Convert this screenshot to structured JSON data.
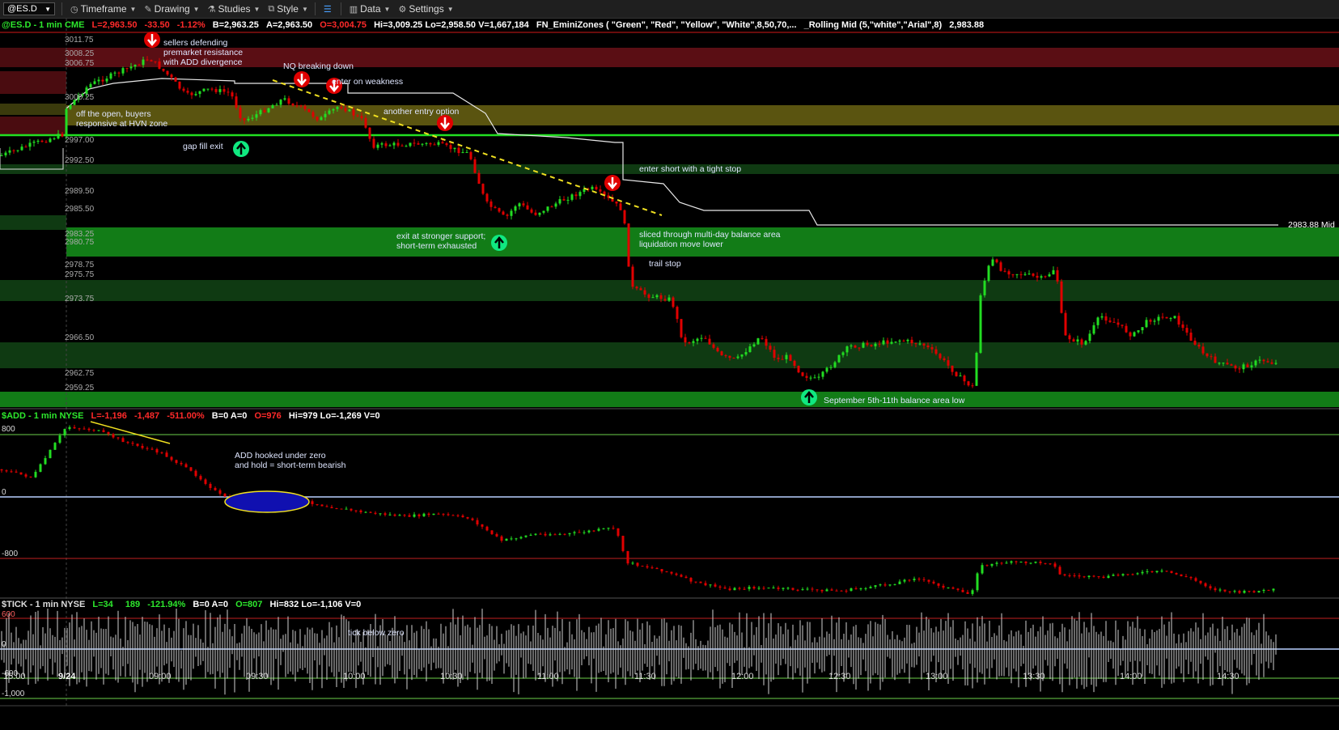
{
  "toolbar": {
    "symbol": "@ES.D",
    "items": [
      {
        "name": "timeframe",
        "label": "Timeframe",
        "icon": "clock-icon"
      },
      {
        "name": "drawing",
        "label": "Drawing",
        "icon": "pencil-icon"
      },
      {
        "name": "studies",
        "label": "Studies",
        "icon": "flask-icon"
      },
      {
        "name": "style",
        "label": "Style",
        "icon": "style-icon"
      },
      {
        "name": "data",
        "label": "Data",
        "icon": "bar-chart-icon"
      },
      {
        "name": "settings",
        "label": "Settings",
        "icon": "gear-icon"
      }
    ]
  },
  "panes": {
    "price": {
      "header_name": "@ES.D - 1 min  CME",
      "last": "L=2,963.50",
      "change": "-33.50",
      "pct": "-1.12%",
      "bid": "B=2,963.25",
      "ask": "A=2,963.50",
      "open": "O=3,004.75",
      "hilo": "Hi=3,009.25  Lo=2,958.50  V=1,667,184",
      "study1": "FN_EminiZones ( \"Green\", \"Red\", \"Yellow\", \"White\",8,50,70,...",
      "study2": "_Rolling Mid (5,\"white\",\"Arial\",8)",
      "study2_value": "2,983.88",
      "mid_label": "2983.88 Mid",
      "price_labels": [
        "3011.75",
        "3008.25",
        "3006.75",
        "3000.25",
        "2997.00",
        "2992.50",
        "2989.50",
        "2985.50",
        "2983.25",
        "2980.75",
        "2978.75",
        "2975.75",
        "2973.75",
        "2966.50",
        "2962.75",
        "2959.25"
      ]
    },
    "add": {
      "header_name": "$ADD - 1 min  NYSE",
      "last": "L=-1,196",
      "change": "-1,487",
      "pct": "-511.00%",
      "ba": "B=0  A=0",
      "open": "O=976",
      "rest": "Hi=979  Lo=-1,269  V=0",
      "levels": [
        "800",
        "0",
        "-800"
      ]
    },
    "tick": {
      "header_name": "$TICK - 1 min  NYSE",
      "last": "L=34",
      "change": "189",
      "pct": "-121.94%",
      "ba": "B=0  A=0",
      "open": "O=807",
      "rest": "Hi=832  Lo=-1,106  V=0",
      "levels": [
        "600",
        "0",
        "-600",
        "-1,000"
      ]
    }
  },
  "annotations": {
    "sellers": "sellers defending\npremarket resistance\nwith ADD divergence",
    "nq": "NQ breaking down",
    "enter_weakness": "enter on weakness",
    "another_entry": "another entry option",
    "off_open": "off the open, buyers\nresponsive at HVN zone",
    "gap_fill": "gap fill exit",
    "enter_short": "enter short with a tight stop",
    "exit_support": "exit at stronger support;\nshort-term exhausted",
    "sliced": "sliced through multi-day balance area\nliquidation move lower",
    "trail": "trail stop",
    "sept": "September 5th-11th balance area low",
    "add_hook": "ADD hooked under zero\nand hold = short-term bearish",
    "tick_below": "tick below zero"
  },
  "time_axis": [
    "15:00",
    "9/24",
    "09:00",
    "09:30",
    "10:00",
    "10:30",
    "11:00",
    "11:30",
    "12:00",
    "12:30",
    "13:00",
    "13:30",
    "14:00",
    "14:30"
  ],
  "colors": {
    "up": "#22dd22",
    "down": "#e00000",
    "zone_red": "#5a0e12",
    "zone_yellow": "#5a5410",
    "zone_green": "#114a14",
    "zone_green_bright": "#148a1a",
    "line_green": "#22e022",
    "zero_line": "#b8d0ff",
    "arrow_down": "#e00000",
    "arrow_up": "#10e880"
  }
}
